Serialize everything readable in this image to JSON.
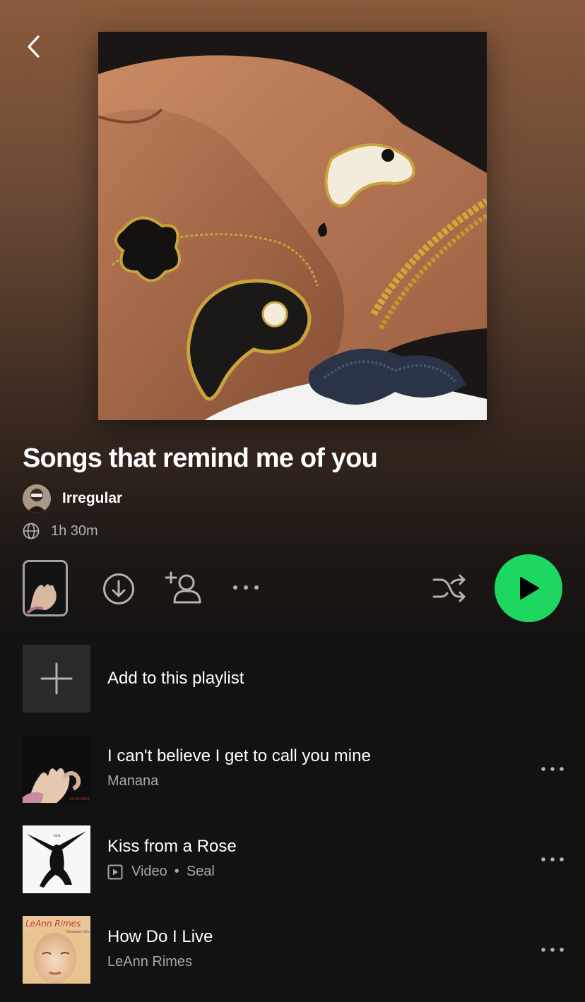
{
  "playlist": {
    "title": "Songs that remind me of you",
    "owner": "Irregular",
    "duration": "1h 30m"
  },
  "add_row": {
    "label": "Add to this playlist"
  },
  "tracks": [
    {
      "title": "I can't believe I get to call you mine",
      "artist": "Manana",
      "video": false,
      "cover_text": "22.04.2016"
    },
    {
      "title": "Kiss from a Rose",
      "artist": "Seal",
      "video": true,
      "video_label": "Video",
      "separator": "•",
      "cover_text": "SEAL"
    },
    {
      "title": "How Do I Live",
      "artist": "LeAnn Rimes",
      "video": false,
      "cover_text": "LeAnn Rimes",
      "cover_subtext": "Greatest Hits"
    }
  ],
  "colors": {
    "accent": "#1ed760",
    "background": "#121212",
    "secondary_text": "#a7a7a7"
  },
  "icons": [
    "back-chevron-icon",
    "globe-icon",
    "download-icon",
    "add-user-icon",
    "more-icon",
    "shuffle-icon",
    "play-icon",
    "plus-icon",
    "video-icon"
  ]
}
